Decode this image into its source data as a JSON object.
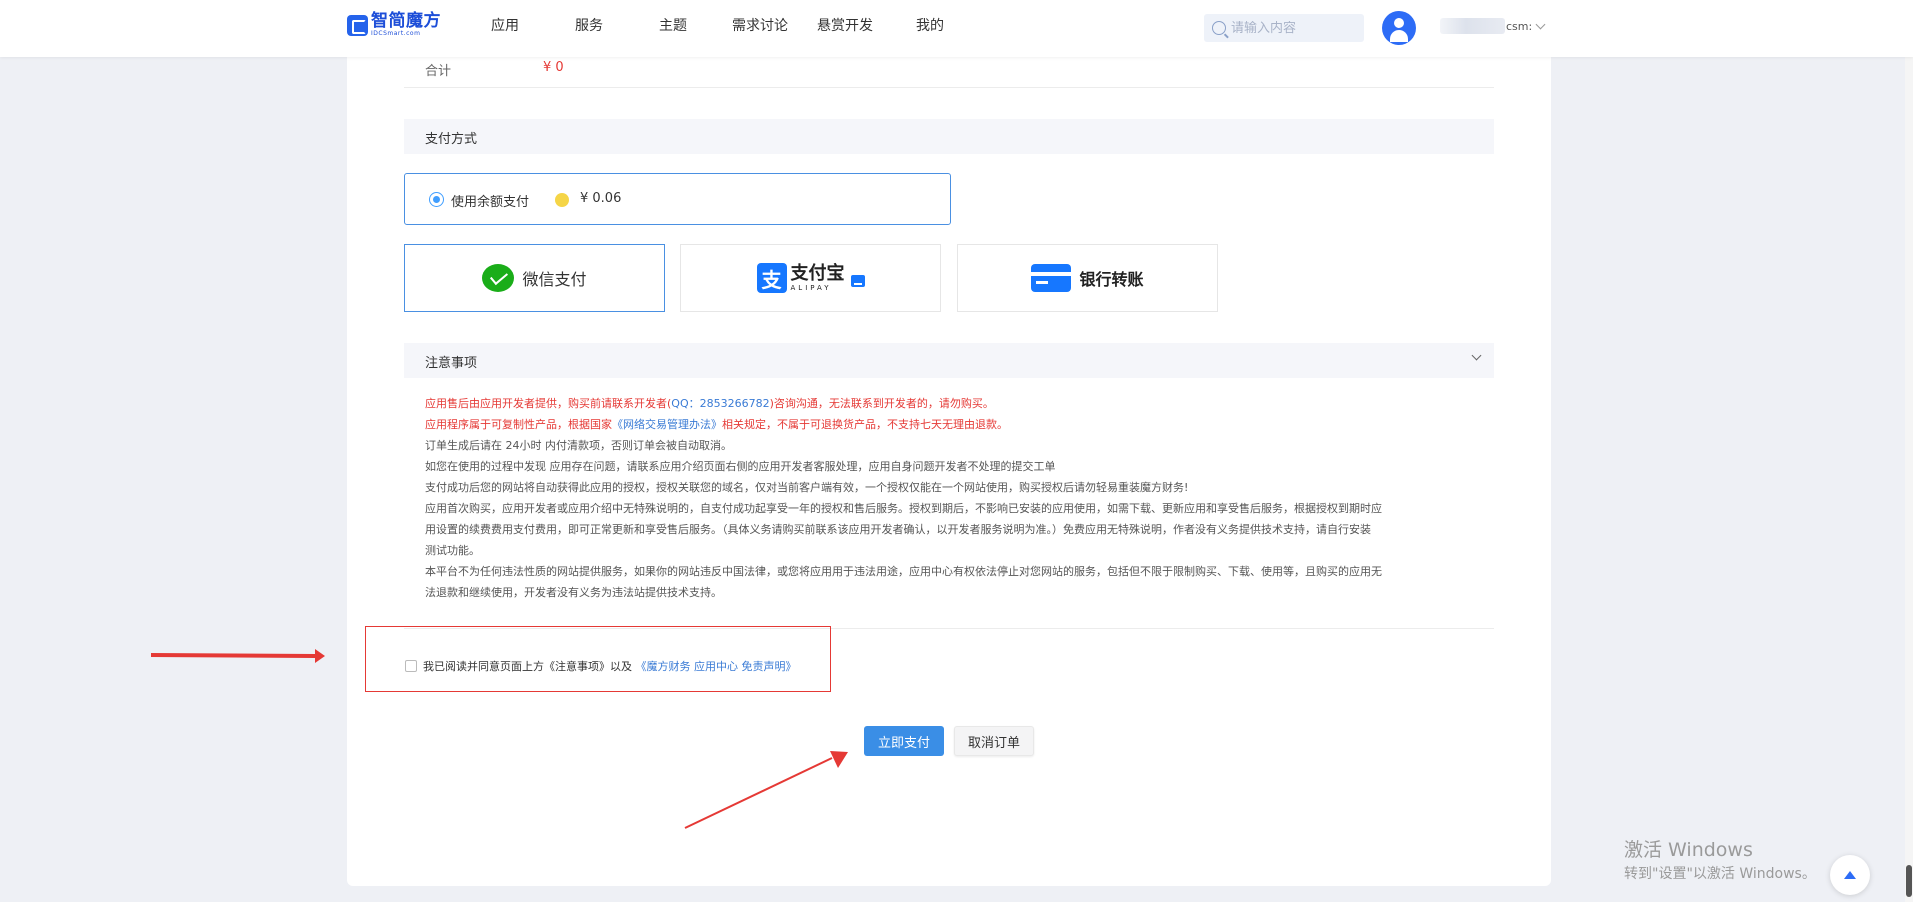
{
  "header": {
    "logo_cn": "智简魔方",
    "logo_en": "IDCSmart.com",
    "nav": [
      "应用",
      "服务",
      "主题",
      "需求讨论",
      "悬赏开发",
      "我的"
    ],
    "search_placeholder": "请输入内容",
    "username_suffix": "csm:"
  },
  "order": {
    "total_label": "合计",
    "total_value": "¥ 0"
  },
  "payment": {
    "section_title": "支付方式",
    "balance_label": "使用余额支付",
    "balance_value": "¥ 0.06",
    "options": {
      "wechat": "微信支付",
      "alipay_cn": "支付宝",
      "alipay_en": "ALIPAY",
      "bank": "银行转账"
    }
  },
  "notice": {
    "title": "注意事项",
    "line1": "应用售后由应用开发者提供，购买前请联系开发者(",
    "line1_qq": "QQ：2853266782",
    "line1_end": ")咨询沟通，无法联系到开发者的，请勿购买。",
    "line2": "应用程序属于可复制性产品，根据国家",
    "line2_link": "《网络交易管理办法》",
    "line2_end": "相关规定，不属于可退换货产品，不支持七天无理由退款。",
    "line3": "订单生成后请在 24小时 内付清款项，否则订单会被自动取消。",
    "line4": "如您在使用的过程中发现 应用存在问题，请联系应用介绍页面右侧的应用开发者客服处理，应用自身问题开发者不处理的提交工单",
    "line5": "支付成功后您的网站将自动获得此应用的授权，授权关联您的域名，仅对当前客户端有效，一个授权仅能在一个网站使用，购买授权后请勿轻易重装魔方财务!",
    "line6": "应用首次购买，应用开发者或应用介绍中无特殊说明的，自支付成功起享受一年的授权和售后服务。授权到期后，不影响已安装的应用使用，如需下载、更新应用和享受售后服务，根据授权到期时应",
    "line7": "用设置的续费费用支付费用，即可正常更新和享受售后服务。（具体义务请购买前联系该应用开发者确认，以开发者服务说明为准。）免费应用无特殊说明，作者没有义务提供技术支持，请自行安装",
    "line8": "测试功能。",
    "line9": "本平台不为任何违法性质的网站提供服务，如果你的网站违反中国法律，或您将应用用于违法用途，应用中心有权依法停止对您网站的服务，包括但不限于限制购买、下载、使用等，且购买的应用无",
    "line10": "法退款和继续使用，开发者没有义务为违法站提供技术支持。"
  },
  "agreement": {
    "text": "我已阅读并同意页面上方《注意事项》以及",
    "link": "《魔方财务 应用中心 免责声明》"
  },
  "actions": {
    "pay": "立即支付",
    "cancel": "取消订单"
  },
  "watermark": {
    "title": "激活 Windows",
    "subtitle": "转到\"设置\"以激活 Windows。"
  },
  "colors": {
    "accent": "#3a8ee6",
    "price_red": "#e53935",
    "annotation_red": "#e53935"
  }
}
